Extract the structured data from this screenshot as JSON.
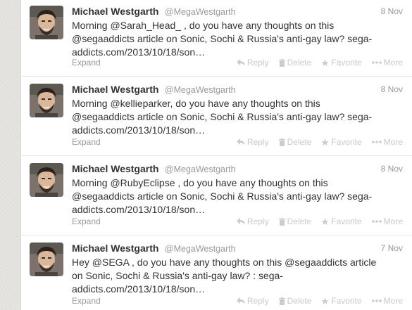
{
  "tweets": [
    {
      "name": "Michael Westgarth",
      "handle": "@MegaWestgarth",
      "time": "8 Nov",
      "lines": [
        "Morning @Sarah_Head_ , do you have any thoughts on this",
        "@segaaddicts article on Sonic, Sochi & Russia's anti-gay law? sega-",
        "addicts.com/2013/10/18/son…"
      ],
      "expand": "Expand"
    },
    {
      "name": "Michael Westgarth",
      "handle": "@MegaWestgarth",
      "time": "8 Nov",
      "lines": [
        "Morning @kellieparker, do you have any thoughts on this",
        "@segaaddicts article on Sonic, Sochi & Russia's anti-gay law? sega-",
        "addicts.com/2013/10/18/son…"
      ],
      "expand": "Expand"
    },
    {
      "name": "Michael Westgarth",
      "handle": "@MegaWestgarth",
      "time": "8 Nov",
      "lines": [
        "Morning @RubyEclipse , do you have any thoughts on this",
        "@segaaddicts article on Sonic, Sochi & Russia's anti-gay law? sega-",
        "addicts.com/2013/10/18/son…"
      ],
      "expand": "Expand"
    },
    {
      "name": "Michael Westgarth",
      "handle": "@MegaWestgarth",
      "time": "7 Nov",
      "lines": [
        "Hey @SEGA , do you have any thoughts on this @segaaddicts article",
        "on Sonic, Sochi & Russia's anti-gay law? :  sega-",
        "addicts.com/2013/10/18/son…"
      ],
      "expand": "Expand"
    }
  ],
  "actions": {
    "reply": "Reply",
    "delete": "Delete",
    "favorite": "Favorite",
    "more": "More"
  },
  "icons": {
    "reply": "reply-arrow-icon",
    "delete": "trash-icon",
    "favorite": "star-icon",
    "more": "ellipsis-icon"
  }
}
